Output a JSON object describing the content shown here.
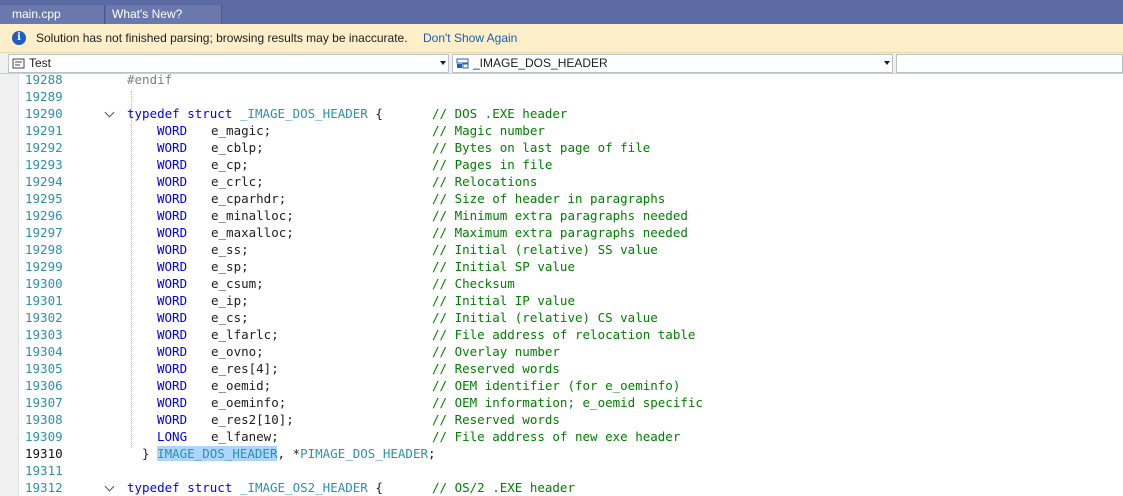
{
  "tabs": [
    {
      "label": "main.cpp"
    },
    {
      "label": "What's New?"
    }
  ],
  "infobar": {
    "message": "Solution has not finished parsing; browsing results may be inaccurate.",
    "link": "Don't Show Again"
  },
  "navbar": {
    "project": "Test",
    "scope": "_IMAGE_DOS_HEADER",
    "member": ""
  },
  "colors": {
    "tabbar": "#5b6aa2",
    "keyword": "#0000ff",
    "type": "#2b91af",
    "comment": "#008000",
    "line_number": "#2b91af",
    "selection": "#add6ff",
    "infobar": "#fcefc9"
  },
  "editor": {
    "lines": [
      {
        "n": "19288",
        "pp": "#endif"
      },
      {
        "n": "19289"
      },
      {
        "n": "19290",
        "kw": "typedef struct",
        "typ": "_IMAGE_DOS_HEADER",
        "rest": " {",
        "comment": "// DOS .EXE header"
      },
      {
        "n": "19291",
        "type": "WORD",
        "field": "e_magic;",
        "comment": "// Magic number"
      },
      {
        "n": "19292",
        "type": "WORD",
        "field": "e_cblp;",
        "comment": "// Bytes on last page of file"
      },
      {
        "n": "19293",
        "type": "WORD",
        "field": "e_cp;",
        "comment": "// Pages in file"
      },
      {
        "n": "19294",
        "type": "WORD",
        "field": "e_crlc;",
        "comment": "// Relocations"
      },
      {
        "n": "19295",
        "type": "WORD",
        "field": "e_cparhdr;",
        "comment": "// Size of header in paragraphs"
      },
      {
        "n": "19296",
        "type": "WORD",
        "field": "e_minalloc;",
        "comment": "// Minimum extra paragraphs needed"
      },
      {
        "n": "19297",
        "type": "WORD",
        "field": "e_maxalloc;",
        "comment": "// Maximum extra paragraphs needed"
      },
      {
        "n": "19298",
        "type": "WORD",
        "field": "e_ss;",
        "comment": "// Initial (relative) SS value"
      },
      {
        "n": "19299",
        "type": "WORD",
        "field": "e_sp;",
        "comment": "// Initial SP value"
      },
      {
        "n": "19300",
        "type": "WORD",
        "field": "e_csum;",
        "comment": "// Checksum"
      },
      {
        "n": "19301",
        "type": "WORD",
        "field": "e_ip;",
        "comment": "// Initial IP value"
      },
      {
        "n": "19302",
        "type": "WORD",
        "field": "e_cs;",
        "comment": "// Initial (relative) CS value"
      },
      {
        "n": "19303",
        "type": "WORD",
        "field": "e_lfarlc;",
        "comment": "// File address of relocation table"
      },
      {
        "n": "19304",
        "type": "WORD",
        "field": "e_ovno;",
        "comment": "// Overlay number"
      },
      {
        "n": "19305",
        "type": "WORD",
        "field": "e_res[4];",
        "comment": "// Reserved words"
      },
      {
        "n": "19306",
        "type": "WORD",
        "field": "e_oemid;",
        "comment": "// OEM identifier (for e_oeminfo)"
      },
      {
        "n": "19307",
        "type": "WORD",
        "field": "e_oeminfo;",
        "comment": "// OEM information; e_oemid specific"
      },
      {
        "n": "19308",
        "type": "WORD",
        "field": "e_res2[10];",
        "comment": "// Reserved words"
      },
      {
        "n": "19309",
        "type": "LONG",
        "field": "e_lfanew;",
        "comment": "// File address of new exe header"
      },
      {
        "n": "19310",
        "close": "} ",
        "sel": "IMAGE_DOS_HEADER",
        "mid": ", *",
        "typ2": "PIMAGE_DOS_HEADER",
        "end": ";"
      },
      {
        "n": "19311"
      },
      {
        "n": "19312",
        "kw": "typedef struct",
        "typ": "_IMAGE_OS2_HEADER",
        "rest": " {",
        "comment": "// OS/2 .EXE header"
      }
    ]
  }
}
